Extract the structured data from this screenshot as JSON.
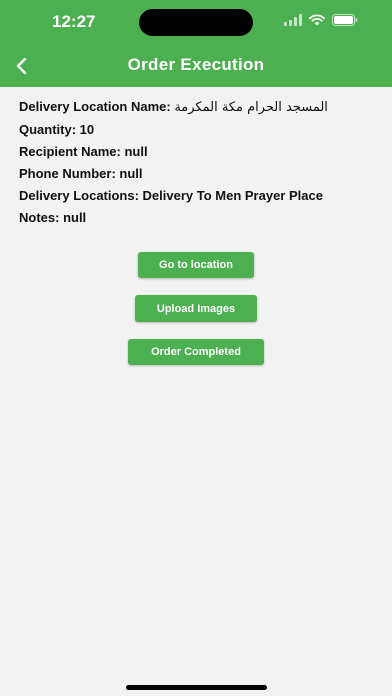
{
  "status_bar": {
    "time": "12:27"
  },
  "app_bar": {
    "title": "Order Execution"
  },
  "details": [
    {
      "label": "Delivery Location Name: ",
      "value": "المسجد الحرام مكة المكرمة",
      "rtl": true
    },
    {
      "label": "Quantity: ",
      "value": "10",
      "rtl": false
    },
    {
      "label": "Recipient Name: ",
      "value": "null",
      "rtl": false
    },
    {
      "label": "Phone Number: ",
      "value": "null",
      "rtl": false
    },
    {
      "label": "Delivery Locations: ",
      "value": "Delivery To Men Prayer Place",
      "rtl": false
    },
    {
      "label": "Notes: ",
      "value": "null",
      "rtl": false
    }
  ],
  "actions": {
    "go_to_location": "Go to location",
    "upload_images": "Upload Images",
    "order_completed": "Order Completed"
  },
  "colors": {
    "accent": "#4caf50",
    "background": "#f2f2f2",
    "text": "#111111"
  },
  "icons": {
    "back": "chevron-left-icon",
    "signal": "signal-icon",
    "wifi": "wifi-icon",
    "battery": "battery-icon"
  }
}
